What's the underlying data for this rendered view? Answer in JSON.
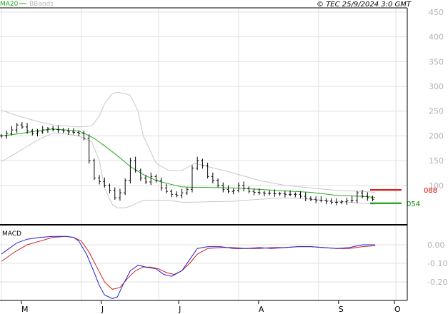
{
  "header": {
    "legend_ma": "MA20",
    "legend_bb": "BBands",
    "copyright": "© TEC 25/9/2024 3:0 GMT"
  },
  "macd_panel": {
    "label": "MACD"
  },
  "colors": {
    "price": "#000000",
    "ma20": "#22aa22",
    "bbands": "#c8c8c8",
    "resistance": "#dd0000",
    "support": "#009900",
    "macd": "#2222cc",
    "signal": "#cc2222",
    "grid": "#e0e0e0"
  },
  "chart_data": [
    {
      "type": "line",
      "title": "",
      "xlabel": "",
      "ylabel": "",
      "ylim": [
        45,
        470
      ],
      "y_ticks": [
        450,
        400,
        350,
        300,
        250,
        200,
        150,
        100
      ],
      "y_tick_labels": [
        "450",
        "400",
        "350",
        "300",
        "250",
        "200",
        "150",
        "100"
      ],
      "x_ticks": [
        {
          "label": "M",
          "day": 0
        },
        {
          "label": "J",
          "day": 31
        },
        {
          "label": "J",
          "day": 61
        },
        {
          "label": "A",
          "day": 92
        },
        {
          "label": "S",
          "day": 123
        },
        {
          "label": "O",
          "day": 153
        }
      ],
      "grid": true,
      "legend": "top-left",
      "series": [
        {
          "name": "MA20",
          "x": [
            0,
            5,
            10,
            15,
            20,
            25,
            30,
            33,
            36,
            40,
            45,
            50,
            55,
            60,
            65,
            70,
            75,
            80,
            90,
            100,
            110,
            120,
            130,
            140,
            145
          ],
          "y": [
            200,
            203,
            207,
            211,
            214,
            212,
            210,
            203,
            195,
            180,
            160,
            138,
            122,
            110,
            103,
            97,
            96,
            96,
            95,
            92,
            89,
            86,
            80,
            78,
            76
          ]
        },
        {
          "name": "BBands",
          "x": [
            0,
            5,
            10,
            15,
            20,
            25,
            30,
            35,
            38,
            40,
            43,
            45,
            48,
            50,
            53,
            55,
            60,
            65,
            70,
            75,
            80,
            90,
            100,
            110,
            120,
            130,
            140,
            145
          ],
          "y": [
            252,
            243,
            235,
            228,
            222,
            220,
            218,
            220,
            240,
            265,
            285,
            288,
            285,
            282,
            250,
            200,
            145,
            130,
            130,
            145,
            138,
            125,
            110,
            100,
            95,
            90,
            88,
            86
          ]
        },
        {
          "name": "",
          "x": [
            0,
            5,
            10,
            15,
            20,
            25,
            30,
            35,
            38,
            40,
            43,
            45,
            48,
            50,
            53,
            55,
            60,
            65,
            70,
            75,
            80,
            90,
            100,
            110,
            120,
            130,
            140,
            145
          ],
          "y": [
            148,
            163,
            179,
            194,
            206,
            204,
            200,
            188,
            150,
            95,
            62,
            55,
            55,
            58,
            65,
            70,
            70,
            70,
            66,
            66,
            67,
            68,
            72,
            75,
            72,
            68,
            64,
            62
          ]
        },
        {
          "name": "",
          "x": [
            0,
            2,
            4,
            6,
            8,
            10,
            12,
            14,
            16,
            18,
            20,
            22,
            24,
            26,
            28,
            30,
            32,
            34,
            36,
            38,
            40,
            42,
            44,
            46,
            48,
            50,
            52,
            54,
            56,
            58,
            60,
            62,
            64,
            66,
            68,
            70,
            72,
            74,
            76,
            78,
            80,
            82,
            84,
            86,
            88,
            90,
            92,
            94,
            96,
            98,
            100,
            102,
            104,
            106,
            108,
            110,
            112,
            114,
            116,
            118,
            120,
            122,
            124,
            126,
            128,
            130,
            132,
            134,
            136,
            138,
            140,
            142,
            144
          ],
          "y": [
            200,
            205,
            212,
            222,
            218,
            210,
            205,
            208,
            212,
            214,
            213,
            212,
            210,
            208,
            207,
            205,
            195,
            150,
            115,
            108,
            100,
            90,
            75,
            85,
            110,
            150,
            130,
            115,
            107,
            118,
            110,
            95,
            88,
            82,
            80,
            85,
            92,
            135,
            150,
            140,
            118,
            110,
            100,
            92,
            88,
            90,
            100,
            94,
            88,
            86,
            85,
            84,
            84,
            83,
            83,
            82,
            82,
            82,
            78,
            74,
            72,
            70,
            70,
            68,
            66,
            66,
            67,
            69,
            70,
            85,
            78,
            75,
            72
          ]
        }
      ],
      "annotations": [
        {
          "label": "088",
          "y": 91,
          "kind": "resistance"
        },
        {
          "label": "054",
          "y": 64,
          "kind": "support"
        }
      ]
    },
    {
      "type": "line",
      "title": "MACD",
      "ylim": [
        -30,
        10
      ],
      "y_ticks": [
        0,
        -10,
        -20
      ],
      "y_tick_labels": [
        "0.00",
        "-0.10",
        "-0.20"
      ],
      "x_ticks": [
        {
          "label": "M",
          "day": 0
        },
        {
          "label": "J",
          "day": 31
        },
        {
          "label": "J",
          "day": 61
        },
        {
          "label": "A",
          "day": 92
        },
        {
          "label": "S",
          "day": 123
        },
        {
          "label": "O",
          "day": 153
        }
      ],
      "grid": true,
      "series": [
        {
          "name": "MACD",
          "x": [
            0,
            3,
            6,
            10,
            15,
            20,
            25,
            28,
            30,
            33,
            36,
            38,
            40,
            43,
            45,
            47,
            50,
            53,
            56,
            60,
            63,
            66,
            70,
            73,
            76,
            80,
            85,
            90,
            95,
            100,
            105,
            110,
            115,
            120,
            125,
            130,
            135,
            140,
            145
          ],
          "y": [
            -5,
            -2,
            1,
            3,
            4,
            4.5,
            4.5,
            4,
            2,
            -5,
            -15,
            -22,
            -27,
            -29,
            -28,
            -22,
            -14,
            -11,
            -12,
            -13,
            -16,
            -17,
            -14,
            -8,
            -2,
            -1,
            -1,
            -2,
            -2,
            -1.5,
            -2,
            -1.5,
            -1,
            -1,
            -1.5,
            -2,
            -1.5,
            0,
            0
          ]
        },
        {
          "name": "Signal",
          "x": [
            0,
            5,
            10,
            15,
            20,
            25,
            28,
            31,
            34,
            37,
            40,
            43,
            46,
            49,
            52,
            55,
            58,
            61,
            64,
            67,
            70,
            73,
            76,
            80,
            85,
            90,
            95,
            100,
            105,
            110,
            115,
            120,
            125,
            130,
            135,
            140,
            145
          ],
          "y": [
            -9,
            -4,
            0,
            2,
            4,
            4.5,
            4,
            2,
            -4,
            -12,
            -20,
            -24,
            -23,
            -18,
            -14,
            -12,
            -12,
            -13,
            -15,
            -16,
            -14,
            -10,
            -5,
            -2,
            -1.5,
            -1.5,
            -2,
            -2,
            -1.5,
            -1.5,
            -1,
            -1,
            -1.5,
            -2,
            -2,
            -1,
            -0.5
          ]
        }
      ]
    }
  ]
}
